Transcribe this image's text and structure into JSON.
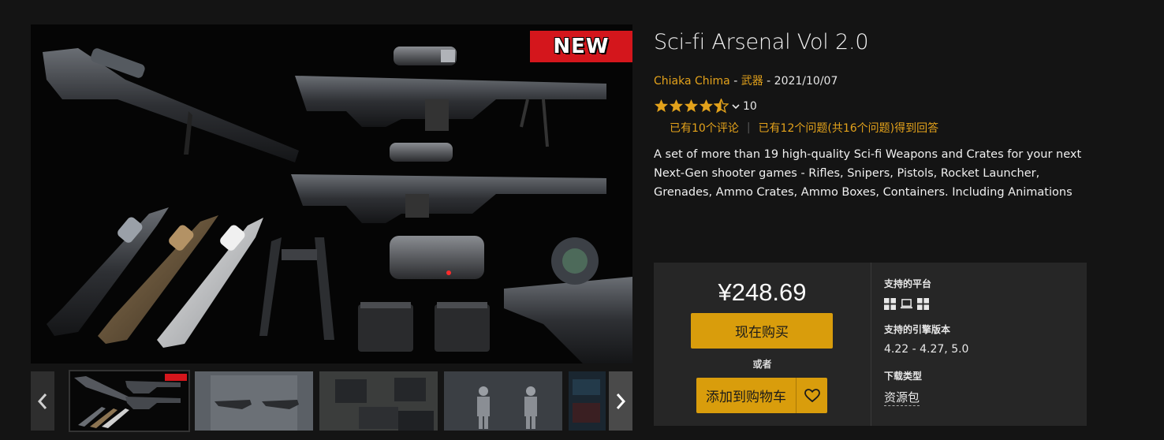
{
  "product": {
    "title": "Sci-fi Arsenal Vol 2.0",
    "author": "Chiaka Chima",
    "category": "武器",
    "date": "2021/10/07",
    "meta_sep1": " - ",
    "meta_sep2": " - ",
    "rating_count": "10",
    "rating_value": 4.5,
    "reviews_link": "已有10个评论",
    "questions_link": "已有12个问题(共16个问题)得到回答",
    "description": "A set of more than 19 high-quality Sci-fi Weapons and Crates for your next Next-Gen shooter games - Rifles, Snipers, Pistols, Rocket Launcher, Grenades, Ammo Crates, Ammo Boxes, Containers. Including Animations"
  },
  "gallery": {
    "badge": "NEW",
    "thumb_badge": "NEW"
  },
  "purchase": {
    "price": "¥248.69",
    "buy_label": "现在购买",
    "or_label": "或者",
    "cart_label": "添加到购物车"
  },
  "specs": {
    "platforms_label": "支持的平台",
    "platforms": [
      "windows-icon",
      "laptop-icon",
      "windows-icon"
    ],
    "engine_label": "支持的引擎版本",
    "engine_versions": "4.22 - 4.27, 5.0",
    "download_label": "下载类型",
    "download_type": "资源包"
  },
  "colors": {
    "accent": "#d99d0c",
    "link": "#e3a21b",
    "badge": "#d4161c",
    "panel": "#262626",
    "background": "#141414"
  }
}
